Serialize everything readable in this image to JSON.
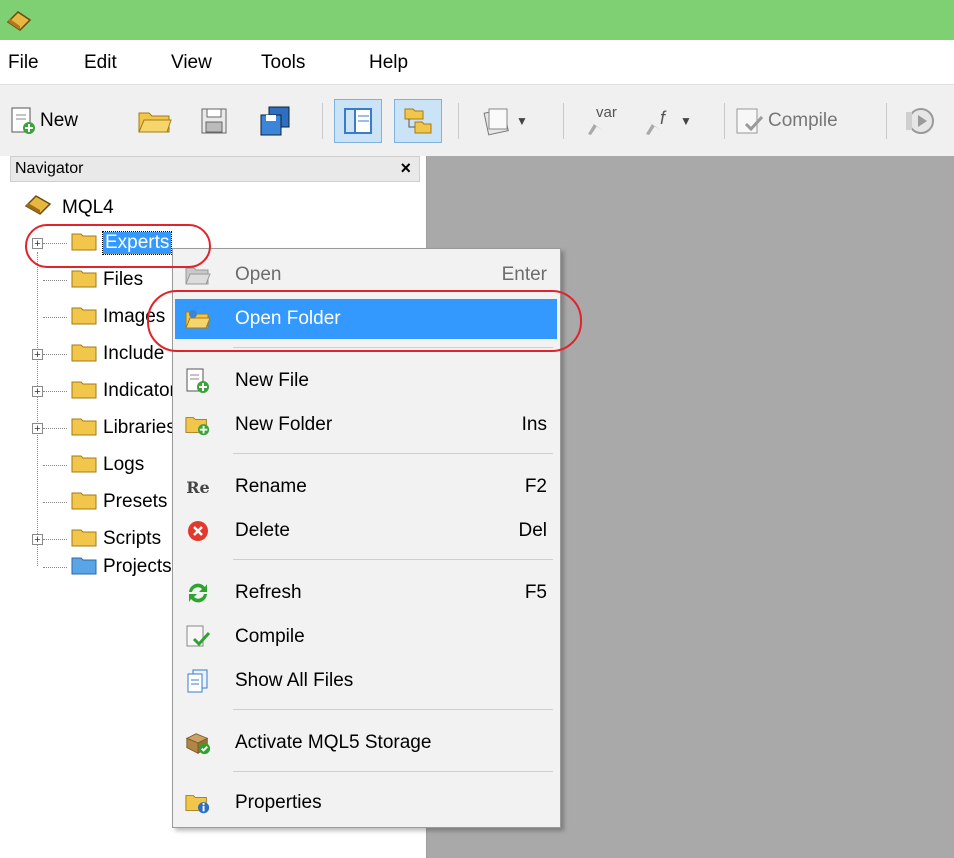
{
  "menubar": {
    "items": [
      "File",
      "Edit",
      "View",
      "Tools",
      "Help"
    ]
  },
  "toolbar": {
    "new_label": "New",
    "compile_label": "Compile",
    "var_label": "var",
    "f_label": "f"
  },
  "navigator": {
    "title": "Navigator",
    "close": "×",
    "root": "MQL4",
    "items": [
      {
        "label": "Experts",
        "expandable": true
      },
      {
        "label": "Files",
        "expandable": false
      },
      {
        "label": "Images",
        "expandable": false
      },
      {
        "label": "Include",
        "expandable": true
      },
      {
        "label": "Indicators",
        "expandable": true
      },
      {
        "label": "Libraries",
        "expandable": true
      },
      {
        "label": "Logs",
        "expandable": false
      },
      {
        "label": "Presets",
        "expandable": false
      },
      {
        "label": "Scripts",
        "expandable": true
      },
      {
        "label": "Projects",
        "expandable": false
      }
    ]
  },
  "context_menu": {
    "items": [
      {
        "label": "Open",
        "shortcut": "Enter",
        "disabled": true
      },
      {
        "label": "Open Folder",
        "shortcut": "",
        "highlighted": true
      },
      {
        "label": "New File",
        "shortcut": ""
      },
      {
        "label": "New Folder",
        "shortcut": "Ins"
      },
      {
        "label": "Rename",
        "shortcut": "F2",
        "icon_text": "Re"
      },
      {
        "label": "Delete",
        "shortcut": "Del"
      },
      {
        "label": "Refresh",
        "shortcut": "F5"
      },
      {
        "label": "Compile",
        "shortcut": ""
      },
      {
        "label": "Show All Files",
        "shortcut": ""
      },
      {
        "label": "Activate MQL5 Storage",
        "shortcut": ""
      },
      {
        "label": "Properties",
        "shortcut": ""
      }
    ]
  },
  "colors": {
    "titlebar": "#7fcf73",
    "highlight": "#3399ff",
    "annotation": "#e0242b",
    "workspace": "#a9a9a9"
  }
}
